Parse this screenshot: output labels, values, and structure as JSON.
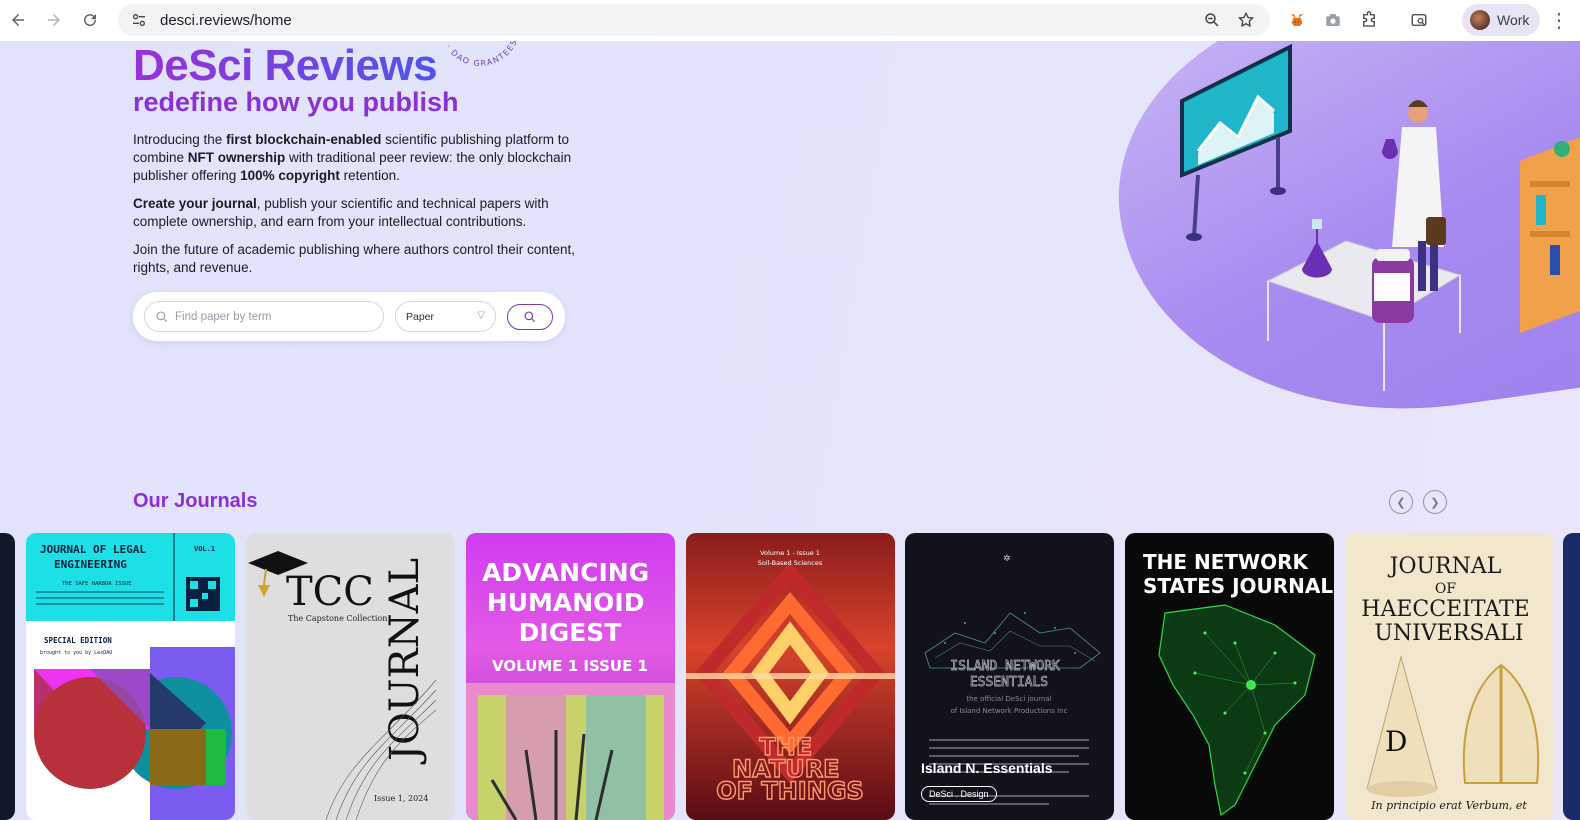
{
  "browser": {
    "url": "desci.reviews/home",
    "profile_label": "Work"
  },
  "hero": {
    "stamp_text": "SCI · DAO GRANTEES ·",
    "title": "DeSci Reviews",
    "subtitle": "redefine how you publish",
    "p1_a": "Introducing the ",
    "p1_b": "first blockchain-enabled",
    "p1_c": " scientific publishing platform to combine ",
    "p1_d": "NFT ownership",
    "p1_e": " with traditional peer review: the only blockchain publisher offering ",
    "p1_f": "100% copyright",
    "p1_g": " retention.",
    "p2_a": "Create your journal",
    "p2_b": ", publish your scientific and technical papers with complete ownership, and earn from your intellectual contributions.",
    "p3": "Join the future of academic publishing where authors control their content, rights, and revenue."
  },
  "search": {
    "placeholder": "Find paper by term",
    "type_selected": "Paper"
  },
  "journals": {
    "title": "Our Journals",
    "cards": [
      {
        "name": "JOURNAL OF LEGAL ENGINEERING",
        "sub": "VOL.1",
        "line1": "THE SAFE HARBOR ISSUE",
        "line2": "SPECIAL EDITION",
        "line3": "brought to you by LexDAO"
      },
      {
        "name": "TCC",
        "sub": "The Capstone Collection",
        "line1": "JOURNAL",
        "line2": "Issue 1, 2024"
      },
      {
        "name": "ADVANCING HUMANOID DIGEST",
        "sub": "VOLUME 1 ISSUE 1"
      },
      {
        "name": "THE NATURE OF THINGS",
        "sub": "Volume 1 - Issue 1",
        "line1": "Soil-Based Sciences"
      },
      {
        "name": "ISLAND NETWORK ESSENTIALS",
        "sub": "the official DeSci journal of Island Network Productions Inc",
        "label": "Island N. Essentials",
        "tag": "DeSci . Design"
      },
      {
        "name": "THE NETWORK STATES JOURNAL"
      },
      {
        "name": "JOURNAL OF HAECCEITATE UNIVERSALI",
        "sub": "In principio erat Verbum, et",
        "line1": "D"
      }
    ]
  }
}
